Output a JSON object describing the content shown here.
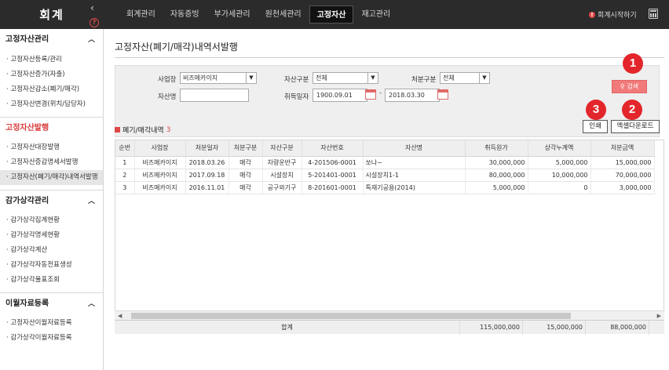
{
  "header": {
    "brand": "회계",
    "menu": [
      {
        "label": "회계관리",
        "active": false
      },
      {
        "label": "자동증빙",
        "active": false
      },
      {
        "label": "부가세관리",
        "active": false
      },
      {
        "label": "원천세관리",
        "active": false
      },
      {
        "label": "고정자산",
        "active": true
      },
      {
        "label": "재고관리",
        "active": false
      }
    ],
    "start_label": "회계시작하기",
    "collapse_glyph": "‹",
    "help_glyph": "?"
  },
  "sidebar": {
    "sections": [
      {
        "title": "고정자산관리",
        "active": false,
        "items": [
          "고정자산등록/관리",
          "고정자산증가(자출)",
          "고정자산감소(폐기/매각)",
          "고정자산변경(위치/담당자)"
        ]
      },
      {
        "title": "고정자산발행",
        "active": true,
        "items": [
          "고정자산대장발행",
          "고정자산증감명세서발행",
          "고정자산(폐기/매각)내역서발행"
        ]
      },
      {
        "title": "감가상각관리",
        "active": false,
        "items": [
          "감가상각집계현황",
          "감가상각명세현황",
          "감가상각계산",
          "감가상각자동전표생성",
          "감가상각율표조회"
        ]
      },
      {
        "title": "이월자료등록",
        "active": false,
        "items": [
          "고정자산이월자료등록",
          "감가상각이월자료등록"
        ]
      }
    ],
    "selected_item": "고정자산(폐기/매각)내역서발행"
  },
  "page": {
    "title": "고정자산(폐기/매각)내역서발행"
  },
  "filters": {
    "workplace_label": "사업장",
    "workplace_value": "비즈메카이지",
    "asset_type_label": "자산구분",
    "asset_type_value": "전체",
    "disposal_type_label": "처분구분",
    "disposal_type_value": "전체",
    "asset_name_label": "자산명",
    "asset_name_value": "",
    "acq_date_label": "취득일자",
    "acq_date_from": "1900.09.01",
    "acq_date_to": "2018.03.30",
    "date_separator": "-",
    "search_label": "검색",
    "search_glyph": "⚲"
  },
  "list": {
    "title": "폐기/매각내역",
    "count": "3",
    "print_label": "인쇄",
    "excel_label": "엑셀다운로드"
  },
  "badges": [
    "1",
    "2",
    "3"
  ],
  "table": {
    "columns": [
      "순번",
      "사업장",
      "처분일자",
      "처분구분",
      "자산구분",
      "자산번호",
      "자산명",
      "취득원가",
      "상각누계액",
      "처분금액"
    ],
    "rows": [
      [
        "1",
        "비즈메카이지",
        "2018.03.26",
        "매각",
        "차량운반구",
        "4-201506-0001",
        "쏘나~",
        "30,000,000",
        "5,000,000",
        "15,000,000"
      ],
      [
        "2",
        "비즈메카이지",
        "2017.09.18",
        "매각",
        "시설장치",
        "5-201401-0001",
        "시설장치1-1",
        "80,000,000",
        "10,000,000",
        "70,000,000"
      ],
      [
        "3",
        "비즈메카이지",
        "2016.11.01",
        "매각",
        "공구와기구",
        "8-201601-0001",
        "특재기공용(2014)",
        "5,000,000",
        "0",
        "3,000,000"
      ]
    ],
    "totals": {
      "label": "합계",
      "acq_cost": "115,000,000",
      "accum_dep": "15,000,000",
      "disposal_amount": "88,000,000"
    }
  },
  "colors": {
    "accent": "#e04848",
    "topbar": "#2b2b2b",
    "badge": "#e3262b"
  }
}
